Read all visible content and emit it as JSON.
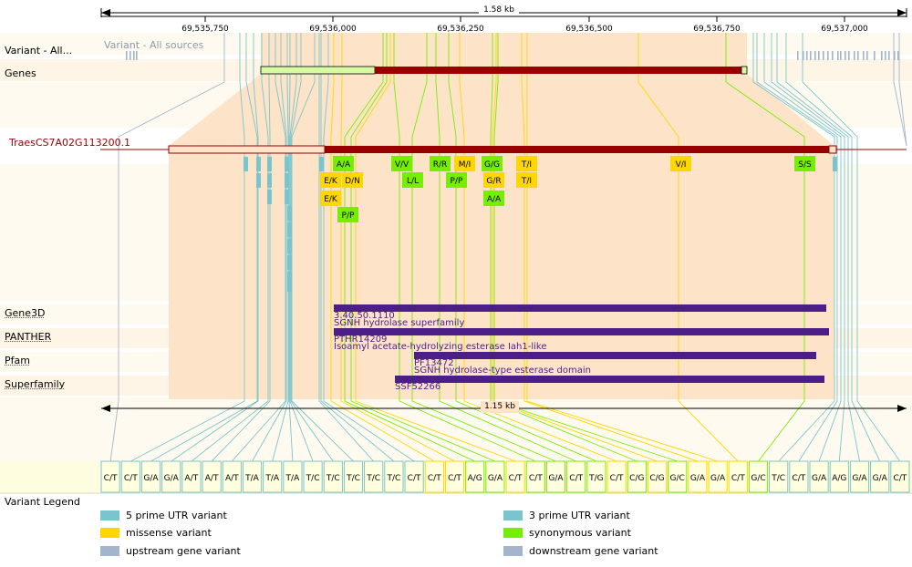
{
  "scale_top": {
    "length_label": "1.58 kb"
  },
  "ruler_ticks": [
    "69,535,750",
    "69,536,000",
    "69,536,250",
    "69,536,500",
    "69,536,750",
    "69,537,000"
  ],
  "tracks": {
    "variant_label": "Variant - All...",
    "variant_sources_label": "Variant - All sources",
    "genes_label": "Genes",
    "transcript_label": "TraesCS7A02G113200.1",
    "gene3d_label": "Gene3D",
    "panther_label": "PANTHER",
    "pfam_label": "Pfam",
    "superfamily_label": "Superfamily"
  },
  "domains": [
    {
      "track": "Gene3D",
      "id": "3.40.50.1110",
      "description": "SGNH hydrolase superfamily"
    },
    {
      "track": "PANTHER",
      "id": "PTHR14209",
      "description": "Isoamyl acetate-hydrolyzing esterase Iah1-like"
    },
    {
      "track": "Pfam",
      "id": "PF13472",
      "description": "SGNH hydrolase-type esterase domain"
    },
    {
      "track": "Superfamily",
      "id": "SSF52266",
      "description": ""
    }
  ],
  "scale_bottom": {
    "length_label": "1.15 kb"
  },
  "protein_variants": [
    {
      "label": "A/A",
      "type": "synonymous"
    },
    {
      "label": "V/V",
      "type": "synonymous"
    },
    {
      "label": "R/R",
      "type": "synonymous"
    },
    {
      "label": "M/I",
      "type": "missense"
    },
    {
      "label": "G/G",
      "type": "synonymous"
    },
    {
      "label": "T/I",
      "type": "missense"
    },
    {
      "label": "V/I",
      "type": "missense"
    },
    {
      "label": "S/S",
      "type": "synonymous"
    },
    {
      "label": "E/K",
      "type": "missense"
    },
    {
      "label": "D/N",
      "type": "missense"
    },
    {
      "label": "L/L",
      "type": "synonymous"
    },
    {
      "label": "P/P",
      "type": "synonymous"
    },
    {
      "label": "G/R",
      "type": "missense"
    },
    {
      "label": "T/I",
      "type": "missense"
    },
    {
      "label": "E/K",
      "type": "missense"
    },
    {
      "label": "A/A",
      "type": "synonymous"
    },
    {
      "label": "P/P",
      "type": "synonymous"
    }
  ],
  "allele_boxes": [
    {
      "label": "C/T",
      "type": "5utr"
    },
    {
      "label": "C/T",
      "type": "5utr"
    },
    {
      "label": "G/A",
      "type": "5utr"
    },
    {
      "label": "G/A",
      "type": "5utr"
    },
    {
      "label": "A/T",
      "type": "5utr"
    },
    {
      "label": "A/T",
      "type": "5utr"
    },
    {
      "label": "A/T",
      "type": "5utr"
    },
    {
      "label": "T/A",
      "type": "5utr"
    },
    {
      "label": "T/A",
      "type": "5utr"
    },
    {
      "label": "T/A",
      "type": "5utr"
    },
    {
      "label": "T/C",
      "type": "5utr"
    },
    {
      "label": "T/C",
      "type": "5utr"
    },
    {
      "label": "T/C",
      "type": "5utr"
    },
    {
      "label": "T/C",
      "type": "5utr"
    },
    {
      "label": "T/C",
      "type": "5utr"
    },
    {
      "label": "C/T",
      "type": "5utr"
    },
    {
      "label": "C/T",
      "type": "missense"
    },
    {
      "label": "C/T",
      "type": "missense"
    },
    {
      "label": "A/G",
      "type": "synonymous"
    },
    {
      "label": "G/A",
      "type": "synonymous"
    },
    {
      "label": "C/T",
      "type": "missense"
    },
    {
      "label": "C/T",
      "type": "synonymous"
    },
    {
      "label": "G/A",
      "type": "synonymous"
    },
    {
      "label": "C/T",
      "type": "synonymous"
    },
    {
      "label": "T/G",
      "type": "synonymous"
    },
    {
      "label": "C/T",
      "type": "missense"
    },
    {
      "label": "C/G",
      "type": "synonymous"
    },
    {
      "label": "C/G",
      "type": "missense"
    },
    {
      "label": "G/C",
      "type": "synonymous"
    },
    {
      "label": "G/A",
      "type": "missense"
    },
    {
      "label": "G/A",
      "type": "missense"
    },
    {
      "label": "C/T",
      "type": "missense"
    },
    {
      "label": "G/C",
      "type": "synonymous"
    },
    {
      "label": "T/C",
      "type": "3utr"
    },
    {
      "label": "C/T",
      "type": "3utr"
    },
    {
      "label": "G/A",
      "type": "3utr"
    },
    {
      "label": "A/G",
      "type": "3utr"
    },
    {
      "label": "G/A",
      "type": "3utr"
    },
    {
      "label": "G/A",
      "type": "3utr"
    },
    {
      "label": "C/T",
      "type": "3utr"
    }
  ],
  "legend": {
    "title": "Variant Legend",
    "items": [
      {
        "label": "5 prime UTR variant",
        "color": "#7ac5cd"
      },
      {
        "label": "3 prime UTR variant",
        "color": "#7ac5cd"
      },
      {
        "label": "missense variant",
        "color": "#ffd700"
      },
      {
        "label": "synonymous variant",
        "color": "#76ee00"
      },
      {
        "label": "upstream gene variant",
        "color": "#a2b5cd"
      },
      {
        "label": "downstream gene variant",
        "color": "#a2b5cd"
      }
    ]
  },
  "colors": {
    "exon_highlight": "#fde3c8",
    "gene_utr": "#d7fba0",
    "gene_coding": "#990000",
    "domain_bar": "#4b1e88",
    "domain_text": "#4b1e88",
    "utr_variant": "#7ac5cd",
    "missense": "#ffd700",
    "synonymous": "#76ee00",
    "line_utr": "#7ac5cd",
    "line_missense": "#ffd700",
    "line_synonymous": "#76ee00",
    "flank": "#a2b5cd"
  }
}
